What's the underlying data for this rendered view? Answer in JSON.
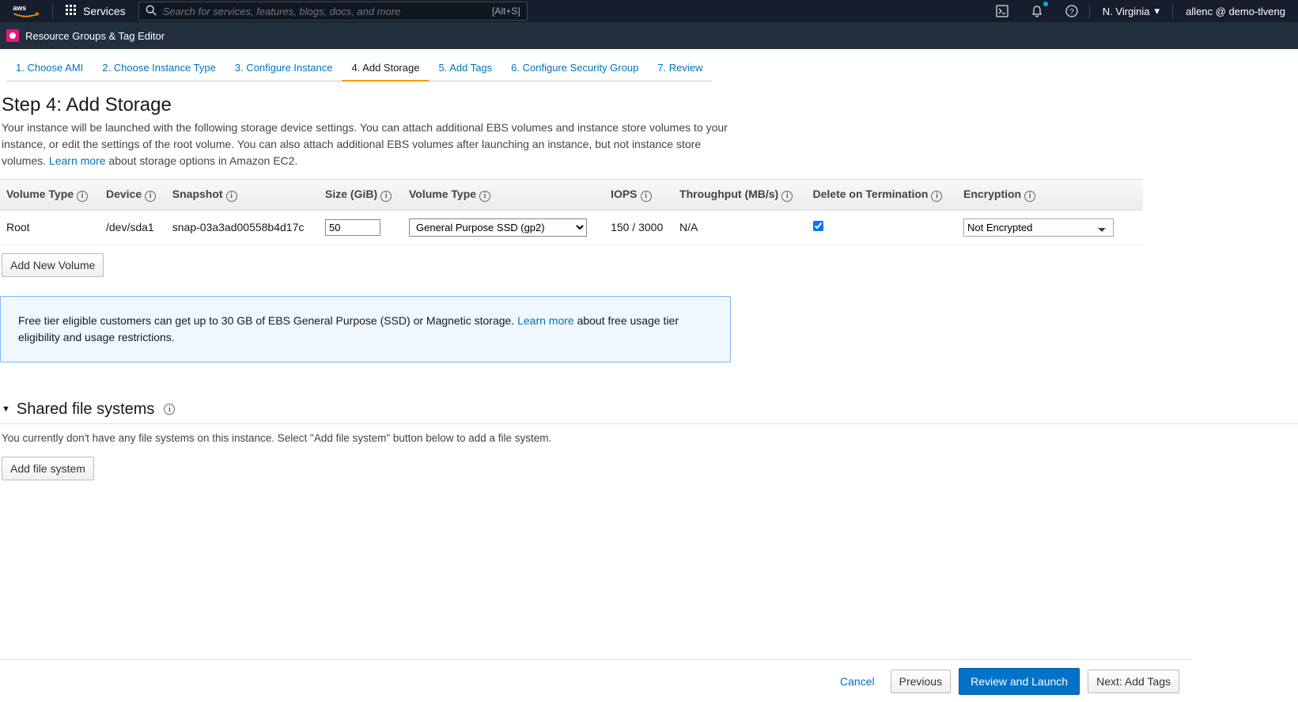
{
  "header": {
    "logo_text": "aws",
    "services_label": "Services",
    "search_placeholder": "Search for services, features, blogs, docs, and more",
    "search_shortcut": "[Alt+S]",
    "region": "N. Virginia",
    "user": "allenc @ demo-tlveng"
  },
  "subnav": {
    "label": "Resource Groups & Tag Editor"
  },
  "wizard": {
    "tabs": [
      "1. Choose AMI",
      "2. Choose Instance Type",
      "3. Configure Instance",
      "4. Add Storage",
      "5. Add Tags",
      "6. Configure Security Group",
      "7. Review"
    ],
    "active_index": 3
  },
  "step": {
    "title": "Step 4: Add Storage",
    "desc_part1": "Your instance will be launched with the following storage device settings. You can attach additional EBS volumes and instance store volumes to your instance, or edit the settings of the root volume. You can also attach additional EBS volumes after launching an instance, but not instance store volumes. ",
    "learn_more": "Learn more",
    "desc_part2": " about storage options in Amazon EC2."
  },
  "table": {
    "headers": {
      "volume_type": "Volume Type",
      "device": "Device",
      "snapshot": "Snapshot",
      "size": "Size (GiB)",
      "volume_type2": "Volume Type",
      "iops": "IOPS",
      "throughput": "Throughput (MB/s)",
      "delete_on_termination": "Delete on Termination",
      "encryption": "Encryption"
    },
    "row": {
      "vol_type": "Root",
      "device": "/dev/sda1",
      "snapshot": "snap-03a3ad00558b4d17c",
      "size": "50",
      "vol_type2": "General Purpose SSD (gp2)",
      "iops": "150 / 3000",
      "throughput": "N/A",
      "delete_checked": true,
      "encryption": "Not Encrypted"
    },
    "add_volume": "Add New Volume"
  },
  "info_box": {
    "text1": "Free tier eligible customers can get up to 30 GB of EBS General Purpose (SSD) or Magnetic storage. ",
    "learn_more": "Learn more",
    "text2": " about free usage tier eligibility and usage restrictions."
  },
  "sfs": {
    "title": "Shared file systems",
    "desc": "You currently don't have any file systems on this instance. Select \"Add file system\" button below to add a file system.",
    "add_btn": "Add file system"
  },
  "footer": {
    "cancel": "Cancel",
    "previous": "Previous",
    "review": "Review and Launch",
    "next": "Next: Add Tags"
  }
}
